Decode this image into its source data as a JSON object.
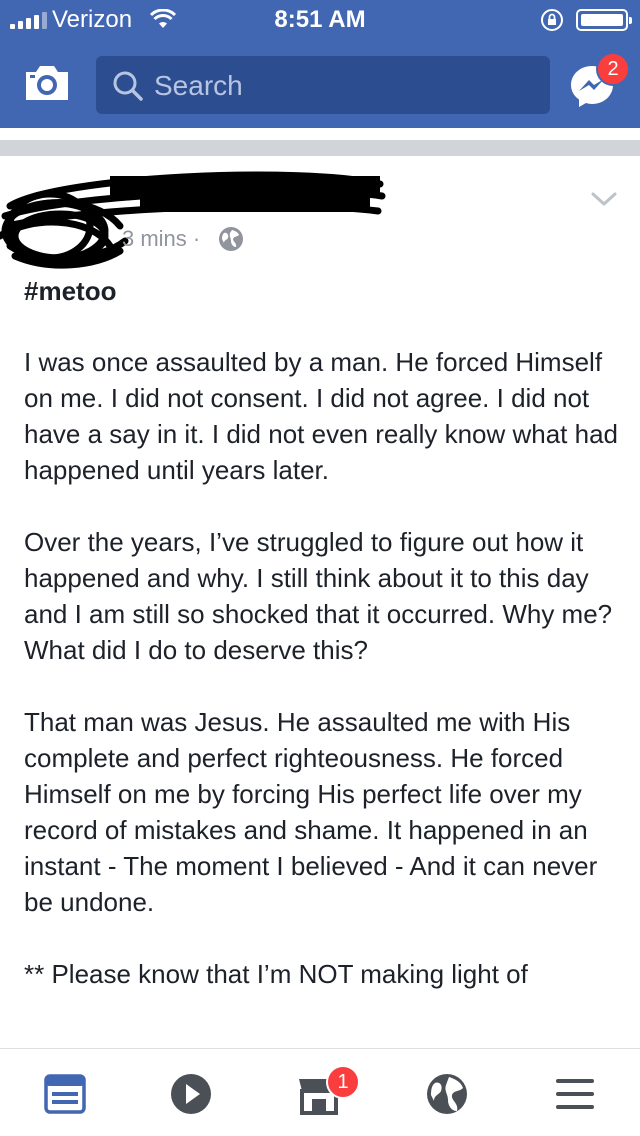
{
  "status_bar": {
    "carrier": "Verizon",
    "time": "8:51 AM"
  },
  "nav": {
    "search_placeholder": "Search",
    "messenger_badge": "2"
  },
  "post": {
    "timestamp": "3 mins ·",
    "hashtag": "#metoo",
    "paragraphs": [
      "I was once assaulted by a man. He forced Himself on me. I did not consent. I did not agree. I did not have a say in it. I did not even really know what had happened until years later.",
      "Over the years, I’ve struggled to figure out how it happened and why. I still think about it to this day and I am still so shocked that it occurred. Why me? What did I do to deserve this?",
      "That man was Jesus. He assaulted me with His complete and perfect righteousness. He forced Himself on me by forcing His perfect life over my record of mistakes and shame. It happened in an instant - The moment I believed - And it can never be undone.",
      "** Please know that I’m NOT making light of"
    ]
  },
  "tab_bar": {
    "notifications_badge": "1"
  },
  "colors": {
    "brand_blue": "#4267b2",
    "search_bg": "#2c4d8f",
    "badge_red": "#fa3e3e",
    "tab_active": "#4267b2",
    "tab_inactive": "#4b4f56"
  }
}
